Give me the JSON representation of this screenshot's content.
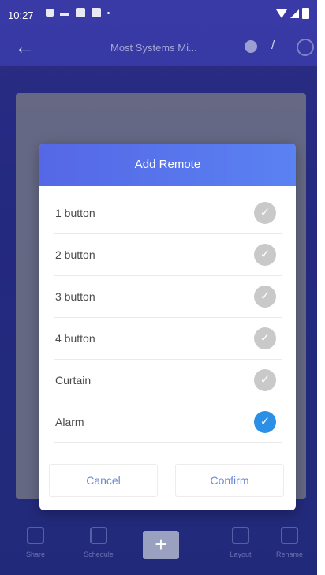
{
  "status_bar": {
    "time": "10:27"
  },
  "app_bar": {
    "title": "Most Systems Mi..."
  },
  "dialog": {
    "title": "Add Remote",
    "options": [
      {
        "label": "1 button",
        "checked": false
      },
      {
        "label": "2 button",
        "checked": false
      },
      {
        "label": "3 button",
        "checked": false
      },
      {
        "label": "4 button",
        "checked": false
      },
      {
        "label": "Curtain",
        "checked": false
      },
      {
        "label": "Alarm",
        "checked": true
      }
    ],
    "cancel_label": "Cancel",
    "confirm_label": "Confirm"
  },
  "bottom_nav": {
    "items": [
      "Share",
      "Schedule",
      "Layout",
      "Rename"
    ]
  },
  "colors": {
    "header_gradient_start": "#5567e6",
    "header_gradient_end": "#5a82f2",
    "check_on": "#2b8fe6",
    "check_off": "#c9c9c9",
    "button_text": "#6c8bd6"
  },
  "icons": {
    "check": "✓",
    "back": "←",
    "add": "+",
    "edit": "/"
  }
}
